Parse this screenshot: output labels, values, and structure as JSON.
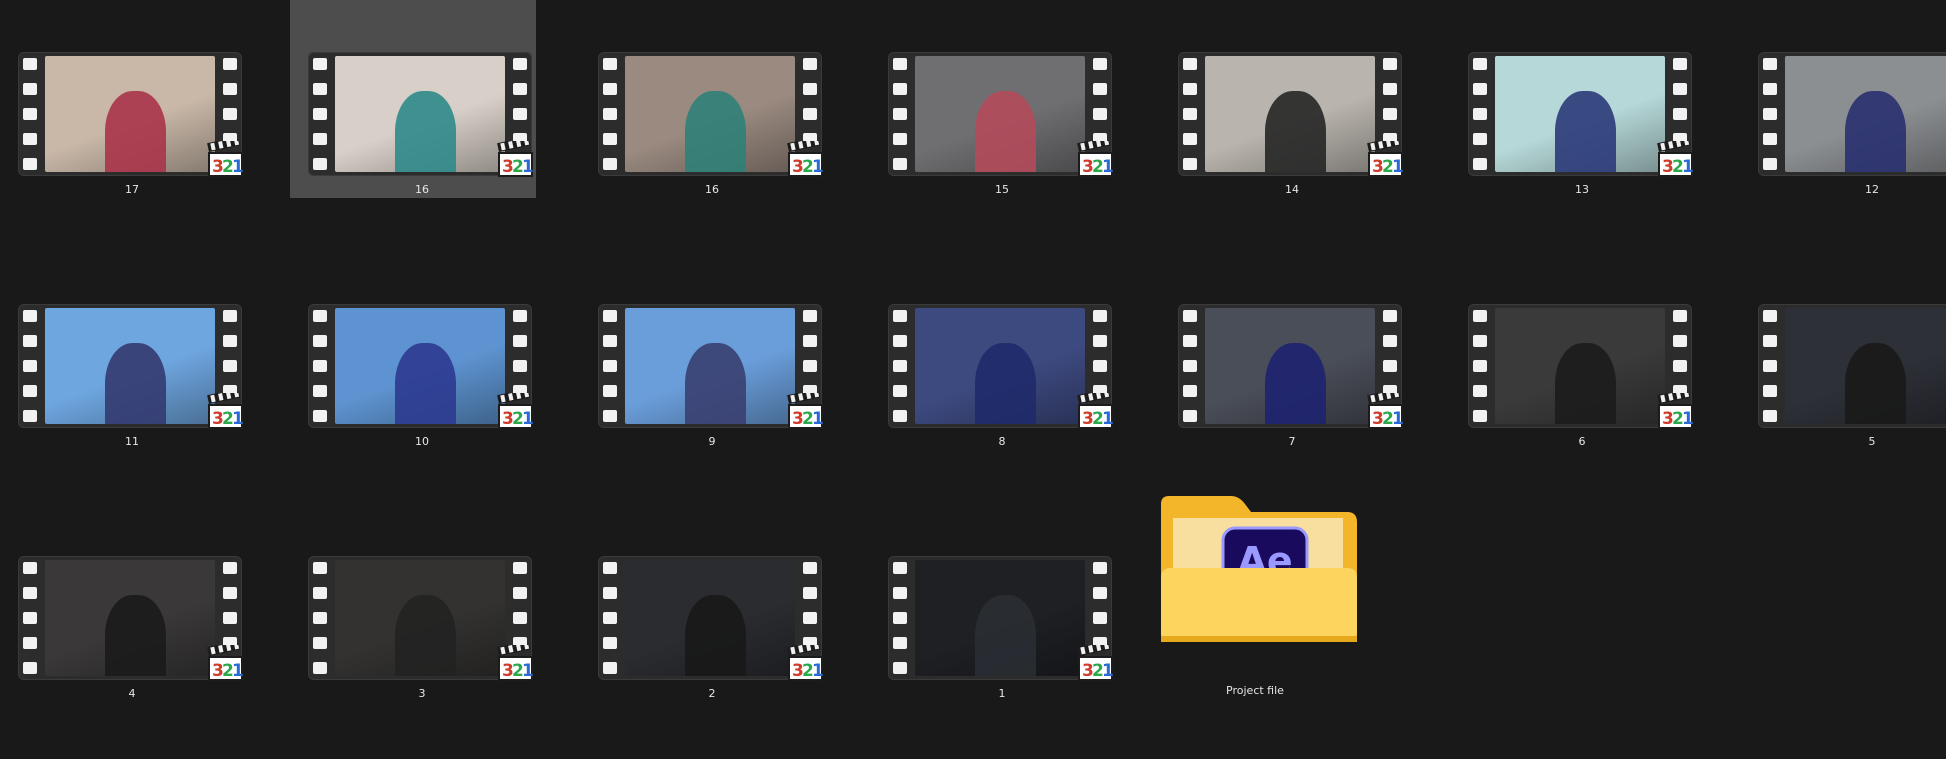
{
  "files": [
    {
      "label": "17",
      "bg": "#c9b8a8",
      "fig": "#a8344a",
      "selected": false
    },
    {
      "label": "16",
      "bg": "#d8d0c8",
      "fig": "#2f8a8a",
      "selected": true
    },
    {
      "label": "16",
      "bg": "#9a8a80",
      "fig": "#2f7f78",
      "selected": false
    },
    {
      "label": "15",
      "bg": "#6f6f72",
      "fig": "#b24a5a",
      "selected": false
    },
    {
      "label": "14",
      "bg": "#b9b4ad",
      "fig": "#262626",
      "selected": false
    },
    {
      "label": "13",
      "bg": "#b6d8d8",
      "fig": "#2b3a78",
      "selected": false
    },
    {
      "label": "12",
      "bg": "#8c8f92",
      "fig": "#283070",
      "selected": false
    },
    {
      "label": "11",
      "bg": "#6ea6e0",
      "fig": "#333a70",
      "selected": false
    },
    {
      "label": "10",
      "bg": "#5d93d0",
      "fig": "#2c3a90",
      "selected": false
    },
    {
      "label": "9",
      "bg": "#6a9edb",
      "fig": "#3a3f70",
      "selected": false
    },
    {
      "label": "8",
      "bg": "#3d4a80",
      "fig": "#1f2a6a",
      "selected": false
    },
    {
      "label": "7",
      "bg": "#4a4e58",
      "fig": "#1e2470",
      "selected": false
    },
    {
      "label": "6",
      "bg": "#3a3a3a",
      "fig": "#1c1c1c",
      "selected": false
    },
    {
      "label": "5",
      "bg": "#2e3038",
      "fig": "#1a1a1a",
      "selected": false
    },
    {
      "label": "4",
      "bg": "#3a3838",
      "fig": "#1b1b1b",
      "selected": false
    },
    {
      "label": "3",
      "bg": "#333230",
      "fig": "#222222",
      "selected": false
    },
    {
      "label": "2",
      "bg": "#2a2c30",
      "fig": "#181818",
      "selected": false
    },
    {
      "label": "1",
      "bg": "#1e2024",
      "fig": "#2a2d33",
      "selected": false
    }
  ],
  "folder": {
    "label": "Project file",
    "app_badge_text": "Ae",
    "icon": "folder-icon"
  },
  "media_badge_text": "321",
  "colors": {
    "background": "#191919",
    "selection": "#4d4d4d",
    "folder_yellow": "#fcd05a",
    "ae_purple": "#1a0a5e",
    "ae_text": "#9999ff"
  }
}
